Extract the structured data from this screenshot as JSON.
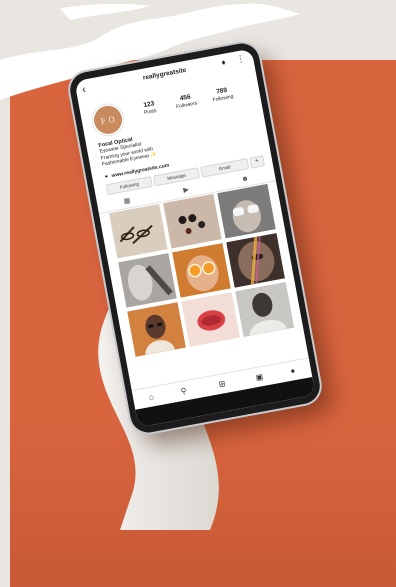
{
  "profile": {
    "handle": "reallygreatsite",
    "avatar_text": "F O",
    "stats": [
      {
        "value": "123",
        "label": "Posts"
      },
      {
        "value": "456",
        "label": "Followers"
      },
      {
        "value": "789",
        "label": "Following"
      }
    ],
    "name": "Focal Optical",
    "bio_lines": [
      "Eyewear Specialist",
      "Framing your world with",
      "Fashionable Eyewear ✨"
    ],
    "website": "www.reallygreatsite.com"
  },
  "actions": {
    "following_label": "Following",
    "message_label": "Message",
    "email_label": "Email"
  },
  "icons": {
    "back": "back-arrow-icon",
    "bell": "bell-icon",
    "more": "more-icon",
    "add_user": "add-user-icon",
    "grid_tab": "grid-icon",
    "reels_tab": "reels-icon",
    "tagged_tab": "tagged-icon",
    "home": "home-icon",
    "search": "search-icon",
    "create": "plus-square-icon",
    "shop": "shop-icon",
    "profile": "profile-icon"
  },
  "colors": {
    "backdrop": "#d9653f",
    "avatar": "#c98a5e",
    "phone_frame": "#1c1c1e",
    "button_bg": "#efefef"
  }
}
